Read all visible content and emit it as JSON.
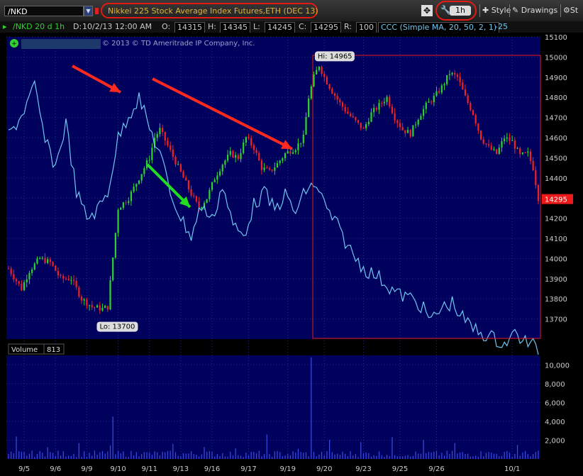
{
  "toolbar": {
    "symbol": "/NKD",
    "symbol_dropdown_icon": "chevron-down-icon",
    "description": "Nikkei 225 Stock Average Index Futures,ETH (DEC 13)",
    "timeframe": "1h",
    "style_label": "Style",
    "drawings_label": "Drawings",
    "studies_label": "St"
  },
  "infobar": {
    "symbol_period": "/NKD 20 d 1h",
    "date_label": "D:",
    "date_value": "10/2/13 12:00 AM",
    "open_label": "O:",
    "open_value": "14315",
    "high_label": "H:",
    "high_value": "14345",
    "low_label": "L:",
    "low_value": "14245",
    "close_label": "C:",
    "close_value": "14295",
    "range_label": "R:",
    "range_value": "100",
    "study_text": "CCC (Simple MA, 20, 50, 2, 1)",
    "study_value": "-25"
  },
  "copyright": "© 2013 © TD Ameritrade IP Company, Inc.",
  "colors": {
    "panel_bg": "#00005d",
    "grid": "#1f2f8f",
    "candle_up": "#2fd22f",
    "candle_down": "#ee2222",
    "overlay_line": "#72c6ef",
    "annotation_red": "#ff2a1f",
    "annotation_green": "#22dd22",
    "current_price_bg": "#ee1a1a",
    "volume_bar": "#3a4de0"
  },
  "chart_data": [
    {
      "type": "candlestick",
      "title": "Nikkei 225 Stock Average Index Futures,ETH (DEC 13)",
      "ylim": [
        13600,
        15100
      ],
      "yticks": [
        13700,
        13800,
        13900,
        14000,
        14100,
        14200,
        14300,
        14400,
        14500,
        14600,
        14700,
        14800,
        14900,
        15000,
        15100
      ],
      "xticks": [
        "9/5",
        "9/6",
        "9/9",
        "9/10",
        "9/11",
        "9/13",
        "9/16",
        "9/17",
        "9/19",
        "9/20",
        "9/23",
        "9/25",
        "9/26",
        "10/1"
      ],
      "annotations": {
        "high_label": "Hi: 14965",
        "low_label": "Lo: 13700",
        "current_price_label": "14295"
      },
      "anchors": [
        [
          0,
          13950
        ],
        [
          5,
          13850
        ],
        [
          8,
          13940
        ],
        [
          12,
          14000
        ],
        [
          16,
          13980
        ],
        [
          20,
          13900
        ],
        [
          24,
          13900
        ],
        [
          28,
          13800
        ],
        [
          32,
          13760
        ],
        [
          36,
          13750
        ],
        [
          38,
          13760
        ],
        [
          42,
          14250
        ],
        [
          46,
          14300
        ],
        [
          50,
          14400
        ],
        [
          54,
          14500
        ],
        [
          56,
          14600
        ],
        [
          58,
          14640
        ],
        [
          61,
          14560
        ],
        [
          64,
          14480
        ],
        [
          67,
          14400
        ],
        [
          70,
          14320
        ],
        [
          73,
          14250
        ],
        [
          76,
          14300
        ],
        [
          79,
          14400
        ],
        [
          82,
          14470
        ],
        [
          85,
          14520
        ],
        [
          88,
          14500
        ],
        [
          91,
          14600
        ],
        [
          94,
          14550
        ],
        [
          97,
          14450
        ],
        [
          100,
          14430
        ],
        [
          103,
          14470
        ],
        [
          106,
          14520
        ],
        [
          110,
          14550
        ],
        [
          113,
          14600
        ],
        [
          115,
          14800
        ],
        [
          117,
          14900
        ],
        [
          119,
          14960
        ],
        [
          121,
          14900
        ],
        [
          124,
          14830
        ],
        [
          127,
          14770
        ],
        [
          130,
          14720
        ],
        [
          133,
          14680
        ],
        [
          136,
          14640
        ],
        [
          139,
          14720
        ],
        [
          142,
          14760
        ],
        [
          145,
          14800
        ],
        [
          148,
          14700
        ],
        [
          151,
          14640
        ],
        [
          154,
          14620
        ],
        [
          157,
          14700
        ],
        [
          160,
          14760
        ],
        [
          163,
          14800
        ],
        [
          166,
          14850
        ],
        [
          169,
          14920
        ],
        [
          172,
          14900
        ],
        [
          175,
          14800
        ],
        [
          178,
          14720
        ],
        [
          181,
          14600
        ],
        [
          184,
          14550
        ],
        [
          187,
          14520
        ],
        [
          190,
          14600
        ],
        [
          193,
          14580
        ],
        [
          196,
          14510
        ],
        [
          199,
          14520
        ],
        [
          201,
          14450
        ],
        [
          203,
          14300
        ]
      ]
    },
    {
      "type": "line",
      "study": "CCC (Simple MA, 20, 50, 2, 1)",
      "note": "overlay, unscaled",
      "anchors": [
        [
          0,
          0.33
        ],
        [
          5,
          0.25
        ],
        [
          10,
          0.14
        ],
        [
          14,
          0.35
        ],
        [
          18,
          0.45
        ],
        [
          22,
          0.28
        ],
        [
          26,
          0.55
        ],
        [
          30,
          0.65
        ],
        [
          34,
          0.62
        ],
        [
          38,
          0.55
        ],
        [
          42,
          0.34
        ],
        [
          46,
          0.25
        ],
        [
          50,
          0.18
        ],
        [
          54,
          0.3
        ],
        [
          58,
          0.4
        ],
        [
          62,
          0.55
        ],
        [
          66,
          0.65
        ],
        [
          70,
          0.72
        ],
        [
          74,
          0.6
        ],
        [
          78,
          0.66
        ],
        [
          82,
          0.52
        ],
        [
          86,
          0.68
        ],
        [
          90,
          0.72
        ],
        [
          94,
          0.6
        ],
        [
          98,
          0.55
        ],
        [
          102,
          0.62
        ],
        [
          106,
          0.56
        ],
        [
          110,
          0.63
        ],
        [
          114,
          0.54
        ],
        [
          118,
          0.52
        ],
        [
          122,
          0.62
        ],
        [
          126,
          0.68
        ],
        [
          130,
          0.76
        ],
        [
          134,
          0.82
        ],
        [
          138,
          0.86
        ],
        [
          142,
          0.88
        ],
        [
          146,
          0.92
        ],
        [
          150,
          0.95
        ],
        [
          154,
          0.96
        ],
        [
          158,
          0.99
        ],
        [
          162,
          1.05
        ],
        [
          166,
          1.0
        ],
        [
          170,
          0.98
        ],
        [
          174,
          1.04
        ],
        [
          178,
          1.08
        ],
        [
          182,
          1.1
        ],
        [
          186,
          1.12
        ],
        [
          190,
          1.14
        ],
        [
          194,
          1.1
        ],
        [
          198,
          1.13
        ],
        [
          203,
          1.16
        ]
      ]
    },
    {
      "type": "bar",
      "title": "Volume",
      "current_value": "813",
      "ylim": [
        0,
        11000
      ],
      "yticks": [
        2000,
        4000,
        6000,
        8000,
        10000
      ],
      "ytick_labels": [
        "2,000",
        "4,000",
        "6,000",
        "8,000",
        "10,000"
      ]
    }
  ]
}
